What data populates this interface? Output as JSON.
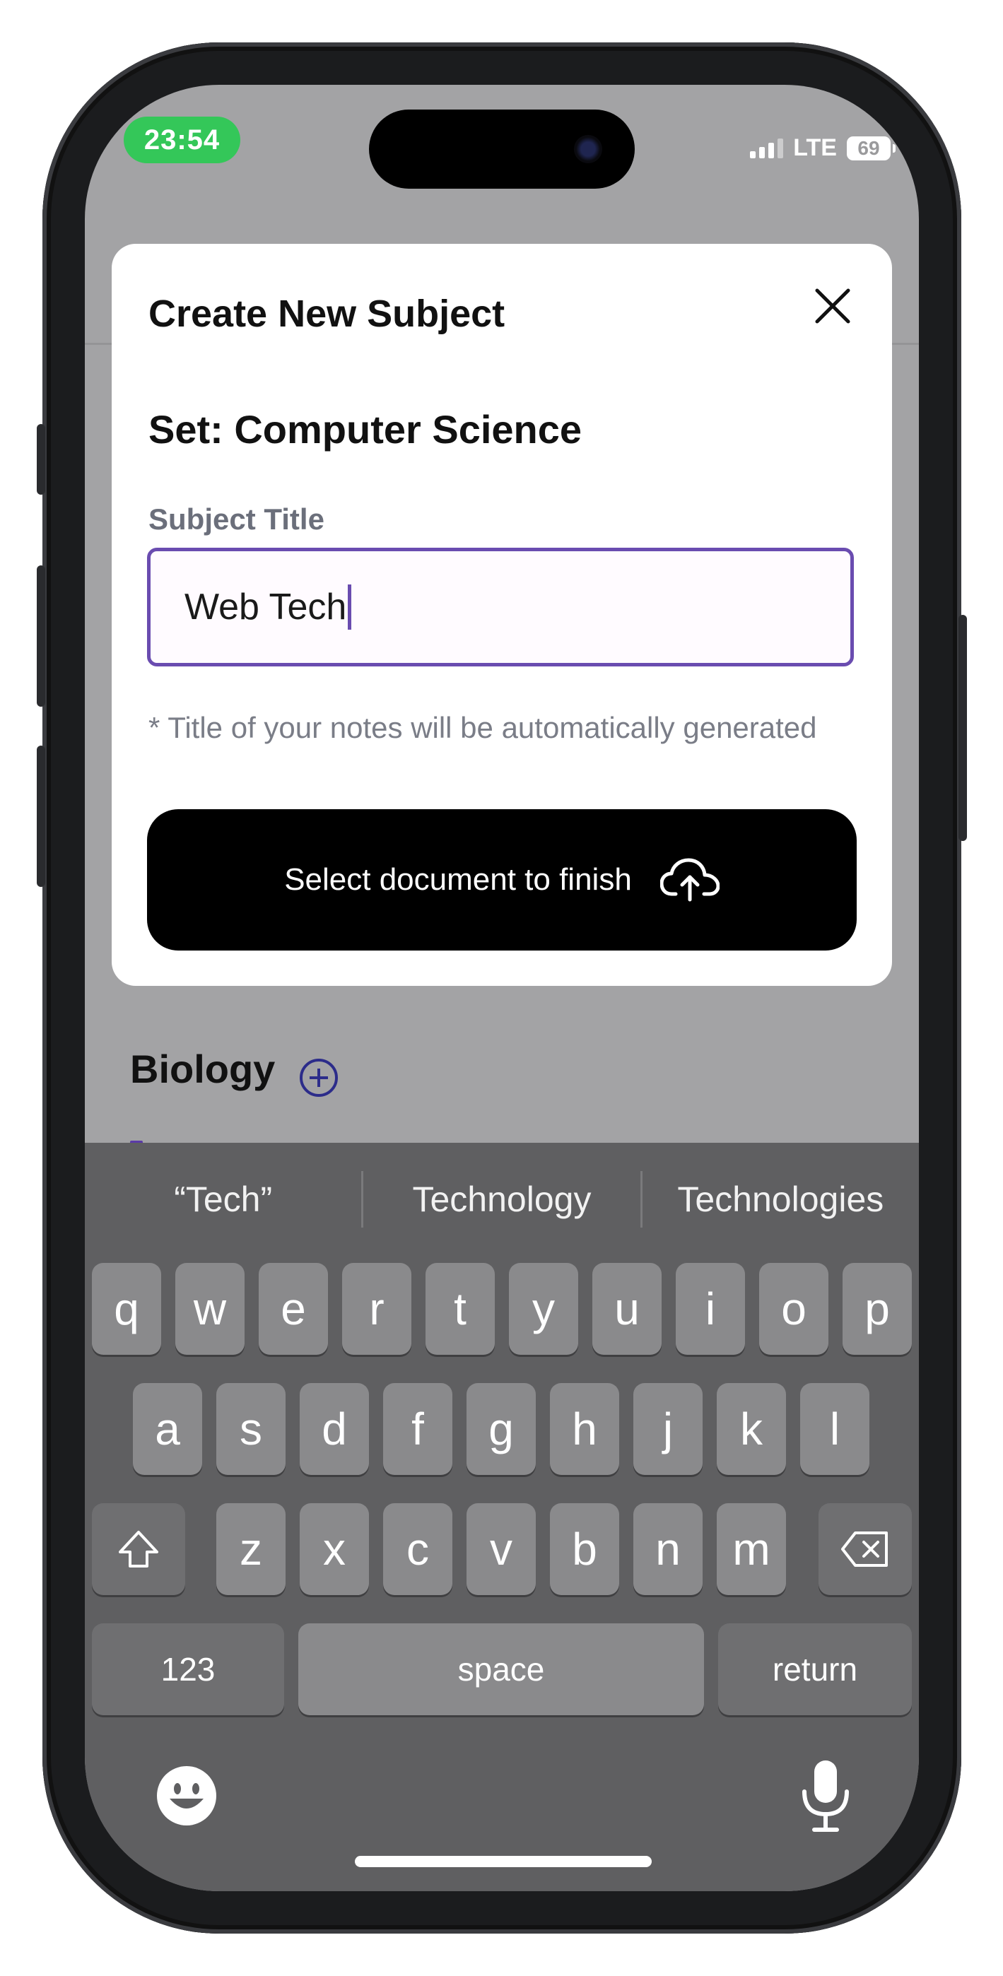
{
  "status_bar": {
    "time": "23:54",
    "network": "LTE",
    "battery": "69"
  },
  "background": {
    "section_title": "Biology"
  },
  "modal": {
    "title": "Create New Subject",
    "set_label": "Set: Computer Science",
    "field_label": "Subject Title",
    "field_value": "Web Tech",
    "hint": "* Title of your notes will be automatically generated",
    "finish_button": "Select document to finish"
  },
  "keyboard": {
    "suggestions": [
      "“Tech”",
      "Technology",
      "Technologies"
    ],
    "row1": [
      "q",
      "w",
      "e",
      "r",
      "t",
      "y",
      "u",
      "i",
      "o",
      "p"
    ],
    "row2": [
      "a",
      "s",
      "d",
      "f",
      "g",
      "h",
      "j",
      "k",
      "l"
    ],
    "row3": [
      "z",
      "x",
      "c",
      "v",
      "b",
      "n",
      "m"
    ],
    "numbers_key": "123",
    "space_key": "space",
    "return_key": "return"
  }
}
